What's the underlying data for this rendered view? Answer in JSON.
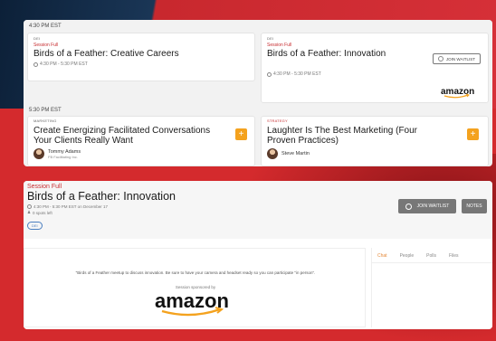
{
  "colors": {
    "accent": "#c72c2f",
    "plus": "#f4a21e",
    "button": "#777777",
    "chat_tab": "#e58a3a"
  },
  "schedule": {
    "slot1": {
      "time": "4:30 PM EST",
      "left": {
        "tag": "DEI",
        "status": "Session Full",
        "title": "Birds of a Feather: Creative Careers",
        "time": "4:30 PM - 5:30 PM EST"
      },
      "right": {
        "tag": "DEI",
        "status": "Session Full",
        "title": "Birds of a Feather: Innovation",
        "time": "4:30 PM - 5:30 PM EST",
        "join": "JOIN WAITLIST",
        "sponsor": "amazon"
      }
    },
    "slot2": {
      "time": "5:30 PM EST",
      "left": {
        "tag": "MARKETING",
        "title": "Create Energizing Facilitated Conversations Your Clients Really Want",
        "speaker": "Tommy Adams",
        "speaker_org": "FB Facilitating Inc.",
        "plus": "+"
      },
      "right": {
        "tag": "STRATEGY",
        "title": "Laughter Is The Best Marketing (Four Proven Practices)",
        "speaker": "Steve Martin",
        "plus": "+"
      }
    }
  },
  "detail": {
    "status": "Session Full",
    "title": "Birds of a Feather: Innovation",
    "time": "4:30 PM - 5:30 PM EST on December 17",
    "spots": "0 spots left",
    "badge": "DEI",
    "join": "JOIN WAITLIST",
    "notes": "NOTES",
    "video_text": "\"Birds of a Feather meetup to discuss innovation. Be sure to have your camera and headset ready so you can participate \"in person\".",
    "sponsor_text": "Session sponsored by",
    "sponsor": "amazon",
    "tabs": [
      "Chat",
      "People",
      "Polls",
      "Files"
    ]
  }
}
